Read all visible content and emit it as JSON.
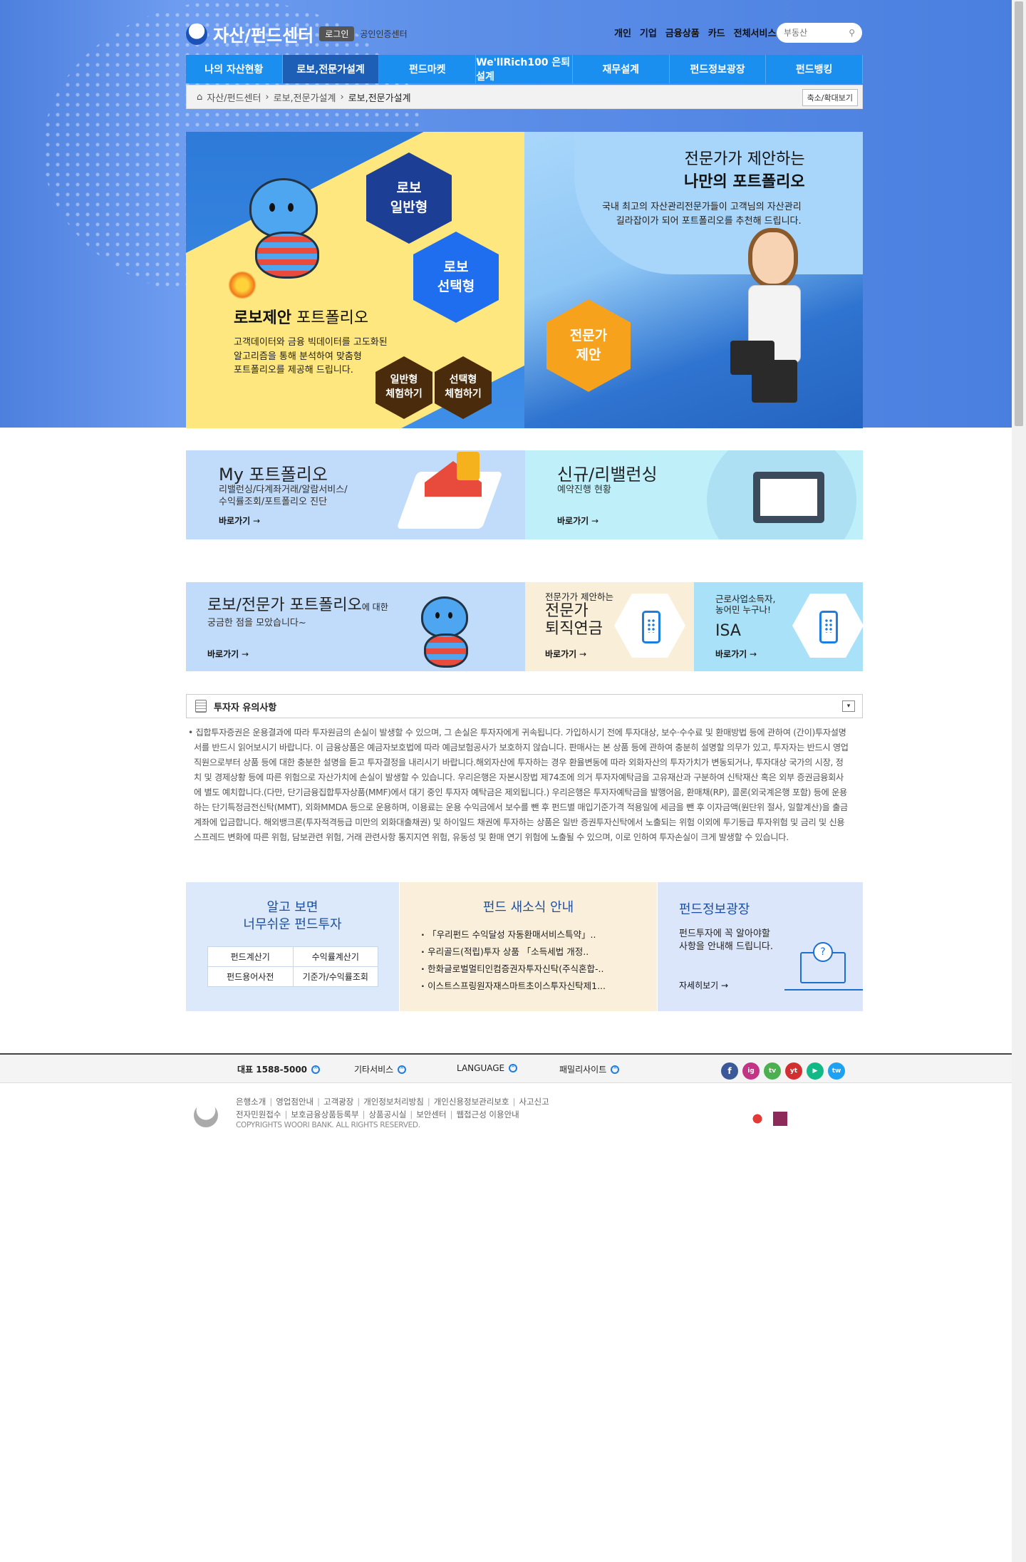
{
  "header": {
    "logo_text": "자산/펀드센터",
    "login_label": "로그인",
    "cert_label": "공인인증센터",
    "top_nav": [
      "개인",
      "기업",
      "금융상품",
      "카드",
      "전체서비스"
    ],
    "search_placeholder": "부동산"
  },
  "gnb": {
    "items": [
      "나의 자산현황",
      "로보,전문가설계",
      "펀드마켓",
      "We'llRich100 은퇴설계",
      "재무설계",
      "펀드정보광장",
      "펀드뱅킹"
    ],
    "active": 1
  },
  "breadcrumb": {
    "items": [
      "자산/펀드센터",
      "로보,전문가설계",
      "로보,전문가설계"
    ],
    "zoom_label": "축소/확대보기"
  },
  "banner": {
    "left": {
      "hex_general": "로보\n일반형",
      "hex_select": "로보\n선택형",
      "title_bold": "로보제안",
      "title_rest": " 포트폴리오",
      "desc": "고객데이터와 금융 빅데이터를 고도화된\n알고리즘을 통해 분석하여 맞춤형\n포트폴리오를 제공해 드립니다.",
      "try_general": "일반형\n체험하기",
      "try_select": "선택형\n체험하기"
    },
    "right": {
      "title_line1": "전문가가 제안하는",
      "title_line2": "나만의 포트폴리오",
      "desc": "국내 최고의 자산관리전문가들이 고객님의 자산관리\n길라잡이가 되어 포트폴리오를 추천해 드립니다.",
      "hex_expert": "전문가\n제안"
    }
  },
  "quick": {
    "my": {
      "title": "My 포트폴리오",
      "desc": "리밸런싱/다계좌거래/알람서비스/\n수익률조회/포트폴리오 진단",
      "go": "바로가기"
    },
    "rebal": {
      "title": "신규/리밸런싱",
      "desc": "예약진행 현황",
      "go": "바로가기"
    }
  },
  "row3": {
    "faq": {
      "title": "로보/전문가 포트폴리오",
      "title_suffix": "에 대한",
      "desc": "궁금한 점을 모았습니다~",
      "go": "바로가기"
    },
    "pension": {
      "sub": "전문가가 제안하는",
      "title": "전문가\n퇴직연금",
      "go": "바로가기"
    },
    "isa": {
      "sub": "근로사업소득자,\n농어민 누구나!",
      "title": "ISA",
      "go": "바로가기"
    }
  },
  "notice": {
    "title": "투자자 유의사항",
    "toggle": "▾",
    "text": "집합투자증권은 운용결과에 따라 투자원금의 손실이 발생할 수 있으며, 그 손실은 투자자에게 귀속됩니다. 가입하시기 전에 투자대상, 보수·수수료 및 환매방법 등에 관하여 (간이)투자설명서를 반드시 읽어보시기 바랍니다. 이 금융상품은 예금자보호법에 따라 예금보험공사가 보호하지 않습니다. 판매사는 본 상품 등에 관하여 충분히 설명할 의무가 있고, 투자자는 반드시 영업직원으로부터 상품 등에 대한 충분한 설명을 듣고 투자결정을 내리시기 바랍니다.해외자산에 투자하는 경우 환율변동에 따라 외화자산의 투자가치가 변동되거나, 투자대상 국가의 시장, 정치 및 경제상황 등에 따른 위험으로 자산가치에 손실이 발생할 수 있습니다. 우리은행은 자본시장법 제74조에 의거 투자자예탁금을 고유재산과 구분하여 신탁재산 혹은 외부 증권금융회사에 별도 예치합니다.(다만, 단기금융집합투자상품(MMF)에서 대기 중인 투자자 예탁금은 제외됩니다.) 우리은행은 투자자예탁금을 발행어음, 환매채(RP), 콜론(외국계은행 포함) 등에 운용하는 단기특정금전신탁(MMT), 외화MMDA 등으로 운용하며, 이용료는 운용 수익금에서 보수를 뺀 후 펀드별 매입기준가격 적용일에 세금을 뺀 후 이자금액(원단위 절사, 일할계산)을 출금계좌에 입금합니다. 해외뱅크론(투자적격등급 미만의 외화대출채권) 및 하이일드 채권에 투자하는 상품은 일반 증권투자신탁에서 노출되는 위험 이외에 투기등급 투자위험 및 금리 및 신용스프레드 변화에 따른 위험, 담보관련 위험, 거래 관련사항 통지지연 위험, 유동성 및 환매 연기 위험에 노출될 수 있으며, 이로 인하여 투자손실이 크게 발생할 수 있습니다."
  },
  "bottom": {
    "easy": {
      "title": "알고 보면\n너무쉬운 펀드투자",
      "calc": [
        "펀드계산기",
        "수익률계산기",
        "펀드용어사전",
        "기준가/수익률조회"
      ]
    },
    "news": {
      "title": "펀드 새소식 안내",
      "items": [
        "「우리펀드 수익달성 자동환매서비스특약」..",
        "우리골드(적립)투자 상품 「소득세법 개정..",
        "한화글로벌멀티인컴증권자투자신탁(주식혼합-..",
        "이스트스프링원자재스마트초이스투자신탁제1..."
      ]
    },
    "plaza": {
      "title": "펀드정보광장",
      "desc": "펀드투자에 꼭 알아야할\n사항을 안내해 드립니다.",
      "go": "자세히보기"
    }
  },
  "footer": {
    "menu": [
      "대표 1588-5000",
      "기타서비스",
      "LANGUAGE",
      "패밀리사이트"
    ],
    "links1": [
      "은행소개",
      "영업점안내",
      "고객광장",
      "개인정보처리방침",
      "개인신용정보관리보호",
      "사고신고"
    ],
    "links2": [
      "전자민원접수",
      "보호금융상품등록부",
      "상품공시실",
      "보안센터",
      "웹접근성 이용안내"
    ],
    "copyright": "COPYRIGHTS WOORI BANK. ALL RIGHTS RESERVED.",
    "sns": [
      "f",
      "ig",
      "tv",
      "yt",
      "▶",
      "tw"
    ]
  }
}
